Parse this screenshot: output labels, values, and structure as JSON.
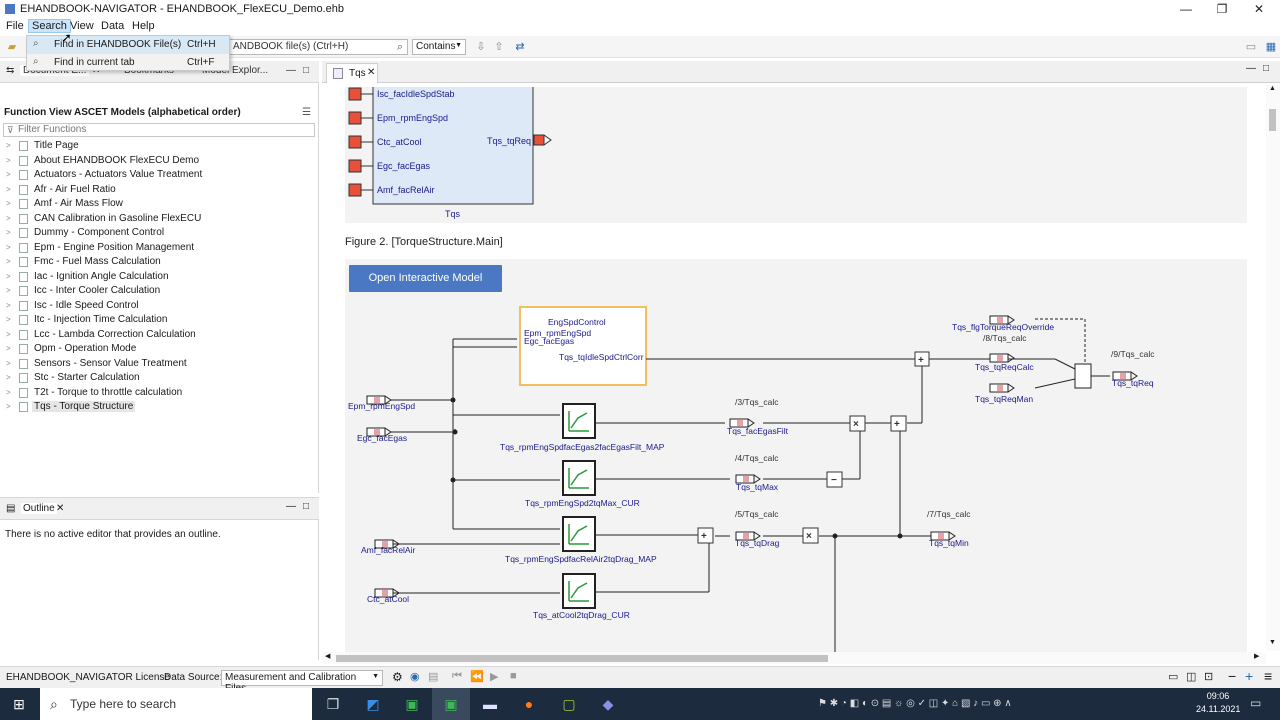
{
  "window": {
    "title": "EHANDBOOK-NAVIGATOR - EHANDBOOK_FlexECU_Demo.ehb",
    "minimize": "—",
    "maximize": "❐",
    "close": "✕"
  },
  "menu": {
    "file": "File",
    "search": "Search",
    "view": "View",
    "data": "Data",
    "help": "Help"
  },
  "search_dropdown": [
    {
      "label": "Find in EHANDBOOK File(s)",
      "shortcut": "Ctrl+H"
    },
    {
      "label": "Find in current tab",
      "shortcut": "Ctrl+F"
    }
  ],
  "toolbar": {
    "search_value": "ANDBOOK file(s) (Ctrl+H)",
    "match_mode": "Contains"
  },
  "left_tabs": {
    "document": "Document E...",
    "bookmarks": "Bookmarks",
    "model": "Model Explor..."
  },
  "function_view": {
    "title": "Function View ASCET Models (alphabetical order)",
    "filter_placeholder": "Filter Functions",
    "items": [
      "Title Page",
      "About EHANDBOOK FlexECU Demo",
      "Actuators - Actuators Value Treatment",
      "Afr - Air Fuel Ratio",
      "Amf - Air Mass Flow",
      "CAN Calibration in Gasoline FlexECU",
      "Dummy - Component Control",
      "Epm - Engine Position Management",
      "Fmc - Fuel Mass Calculation",
      "Iac - Ignition Angle Calculation",
      "Icc - Inter Cooler Calculation",
      "Isc - Idle Speed Control",
      "Itc - Injection Time Calculation",
      "Lcc - Lambda Correction Calculation",
      "Opm - Operation Mode",
      "Sensors - Sensor Value Treatment",
      "Stc - Starter Calculation",
      "T2t - Torque to throttle calculation",
      "Tqs - Torque Structure"
    ],
    "selected": "Tqs - Torque Structure"
  },
  "outline": {
    "title": "Outline",
    "message": "There is no active editor that provides an outline."
  },
  "editor": {
    "tab": "Tqs",
    "figure1": {
      "inputs": [
        "Isc_facIdleSpdStab",
        "Epm_rpmEngSpd",
        "Ctc_atCool",
        "Egc_facEgas",
        "Amf_facRelAir"
      ],
      "output": "Tqs_tqReq",
      "block": "Tqs"
    },
    "figure2_caption": "Figure 2. [TorqueStructure.Main]",
    "open_button": "Open Interactive Model",
    "diagram": {
      "engspd_block": [
        "EngSpdControl",
        "Epm_rpmEngSpd",
        "Egc_facEgas",
        "Tqs_tqIdleSpdCtrlCorr"
      ],
      "inputs": [
        "Epm_rpmEngSpd",
        "Egc_facEgas",
        "Amf_facRelAir",
        "Ctc_atCool"
      ],
      "maps": [
        "Tqs_rpmEngSpdfacEgas2facEgasFilt_MAP",
        "Tqs_rpmEngSpd2tqMax_CUR",
        "Tqs_rpmEngSpdfacRelAir2tqDrag_MAP",
        "Tqs_atCool2tqDrag_CUR"
      ],
      "signals": [
        {
          "ref": "/3/Tqs_calc",
          "name": "Tqs_facEgasFilt"
        },
        {
          "ref": "/4/Tqs_calc",
          "name": "Tqs_tqMax"
        },
        {
          "ref": "/5/Tqs_calc",
          "name": "Tqs_tqDrag"
        },
        {
          "ref": "/7/Tqs_calc",
          "name": "Tqs_tqMin"
        }
      ],
      "override": "Tqs_flgTorqueReqOverride",
      "ref8": "/8/Tqs_calc",
      "reqcalc": "Tqs_tqReqCalc",
      "reqman": "Tqs_tqReqMan",
      "ref9": "/9/Tqs_calc",
      "output": "Tqs_tqReq"
    }
  },
  "statusbar": {
    "license": "EHANDBOOK_NAVIGATOR License",
    "data_source_label": "Data Source:",
    "data_source_value": "Measurement and Calibration Files"
  },
  "taskbar": {
    "search_placeholder": "Type here to search",
    "time": "09:06",
    "date": "24.11.2021"
  }
}
